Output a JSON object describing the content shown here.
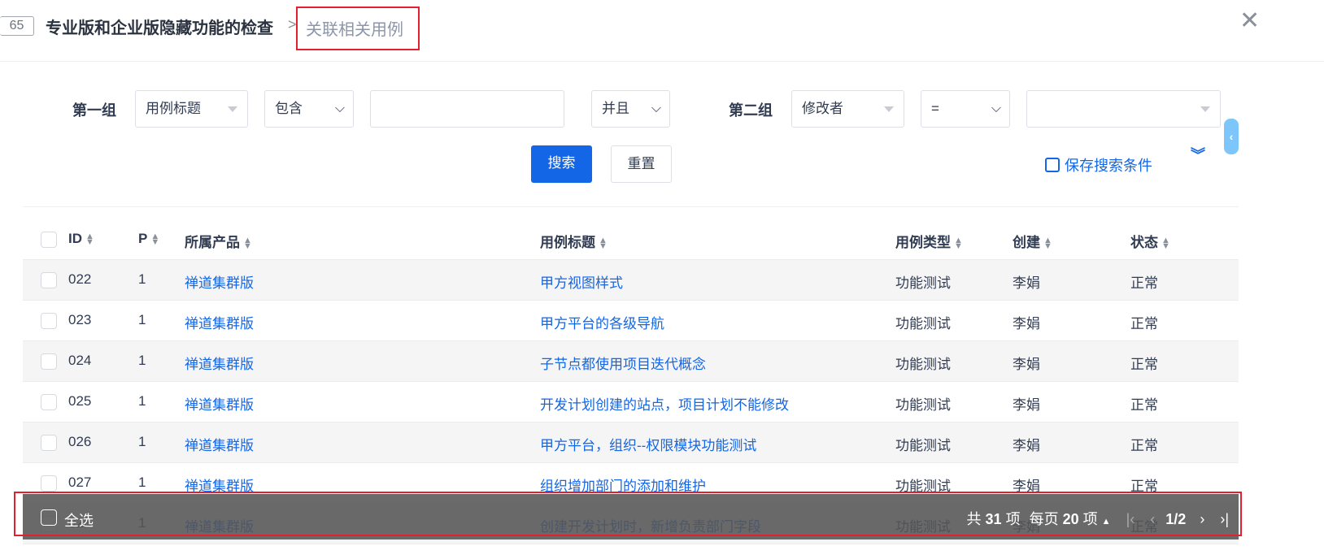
{
  "header": {
    "id": "65",
    "title": "专业版和企业版隐藏功能的检查",
    "separator": ">",
    "crumb": "关联相关用例",
    "close": "✕"
  },
  "search": {
    "group1_label": "第一组",
    "group1_field": "用例标题",
    "group1_op": "包含",
    "group1_value": "",
    "logic": "并且",
    "group2_label": "第二组",
    "group2_field": "修改者",
    "group2_op": "=",
    "group2_value": "",
    "search_btn": "搜索",
    "reset_btn": "重置",
    "save_label": "保存搜索条件"
  },
  "table": {
    "columns": [
      "ID",
      "P",
      "所属产品",
      "用例标题",
      "用例类型",
      "创建",
      "状态"
    ],
    "rows": [
      [
        "022",
        "1",
        "禅道集群版",
        "甲方视图样式",
        "功能测试",
        "李娟",
        "正常"
      ],
      [
        "023",
        "1",
        "禅道集群版",
        "甲方平台的各级导航",
        "功能测试",
        "李娟",
        "正常"
      ],
      [
        "024",
        "1",
        "禅道集群版",
        "子节点都使用项目迭代概念",
        "功能测试",
        "李娟",
        "正常"
      ],
      [
        "025",
        "1",
        "禅道集群版",
        "开发计划创建的站点，项目计划不能修改",
        "功能测试",
        "李娟",
        "正常"
      ],
      [
        "026",
        "1",
        "禅道集群版",
        "甲方平台，组织--权限模块功能测试",
        "功能测试",
        "李娟",
        "正常"
      ],
      [
        "027",
        "1",
        "禅道集群版",
        "组织增加部门的添加和维护",
        "功能测试",
        "李娟",
        "正常"
      ],
      [
        "028",
        "1",
        "禅道集群版",
        "创建开发计划时，新增负责部门字段",
        "功能测试",
        "李娟",
        "正常"
      ]
    ]
  },
  "footer": {
    "select_all": "全选",
    "total_prefix": "共",
    "total": "31",
    "total_suffix": "项",
    "per_page_prefix": "每页",
    "per_page": "20",
    "per_page_suffix": "项",
    "page": "1/2"
  }
}
